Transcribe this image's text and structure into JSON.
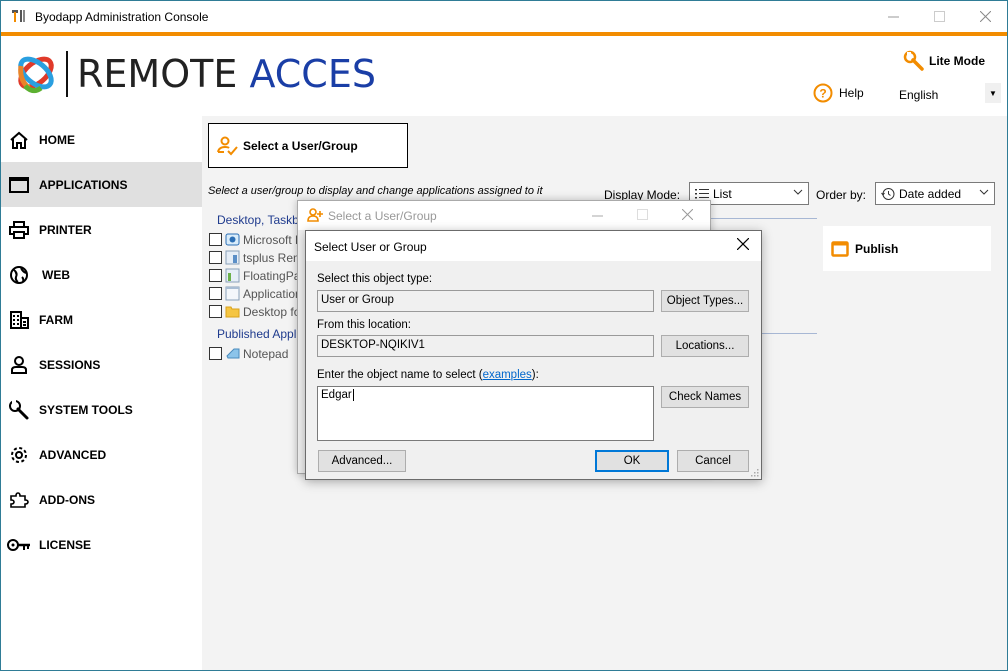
{
  "window": {
    "title": "Byodapp Administration Console",
    "controls": {
      "minimize": "—",
      "maximize": "☐",
      "close": "✕"
    }
  },
  "brand": {
    "logo_text_dark": "REMOTE",
    "logo_text_blue": "ACCES",
    "accent_color": "#f28c00",
    "logo_blue": "#1a3ea6"
  },
  "header": {
    "lite_mode_label": "Lite Mode",
    "help_label": "Help",
    "language_value": "English"
  },
  "sidebar": {
    "items": [
      {
        "label": "HOME",
        "icon": "home-icon",
        "active": false
      },
      {
        "label": "APPLICATIONS",
        "icon": "window-icon",
        "active": true
      },
      {
        "label": "PRINTER",
        "icon": "printer-icon",
        "active": false
      },
      {
        "label": "WEB",
        "icon": "globe-icon",
        "active": false
      },
      {
        "label": "FARM",
        "icon": "building-icon",
        "active": false
      },
      {
        "label": "SESSIONS",
        "icon": "user-icon",
        "active": false
      },
      {
        "label": "SYSTEM TOOLS",
        "icon": "wrench-icon",
        "active": false
      },
      {
        "label": "ADVANCED",
        "icon": "gear-icon",
        "active": false
      },
      {
        "label": "ADD-ONS",
        "icon": "puzzle-icon",
        "active": false
      },
      {
        "label": "LICENSE",
        "icon": "key-icon",
        "active": false
      }
    ]
  },
  "main": {
    "select_user_button": "Select a User/Group",
    "hint": "Select a user/group to display and change applications assigned to it",
    "display_mode_label": "Display Mode:",
    "display_mode_value": "List",
    "order_by_label": "Order by:",
    "order_by_value": "Date added",
    "groups": [
      {
        "title": "Desktop, Taskba",
        "apps": [
          {
            "name": "Microsoft R",
            "checked": false
          },
          {
            "name": "tsplus Rem",
            "checked": false
          },
          {
            "name": "FloatingPa",
            "checked": false
          },
          {
            "name": "Application",
            "checked": false
          },
          {
            "name": "Desktop fo",
            "checked": false
          }
        ]
      },
      {
        "title": "Published Appl",
        "apps": [
          {
            "name": "Notepad",
            "checked": false
          }
        ]
      }
    ],
    "publish_label": "Publish"
  },
  "back_dialog": {
    "title": "Select a User/Group"
  },
  "front_dialog": {
    "title": "Select User or Group",
    "object_type_label": "Select this object type:",
    "object_type_value": "User or Group",
    "object_types_button": "Object Types...",
    "location_label": "From this location:",
    "location_value": "DESKTOP-NQIKIV1",
    "locations_button": "Locations...",
    "object_name_label_prefix": "Enter the object name to select (",
    "object_name_label_link": "examples",
    "object_name_label_suffix": "):",
    "object_name_value": "Edgar",
    "check_names_button": "Check Names",
    "advanced_button": "Advanced...",
    "ok_button": "OK",
    "cancel_button": "Cancel"
  }
}
